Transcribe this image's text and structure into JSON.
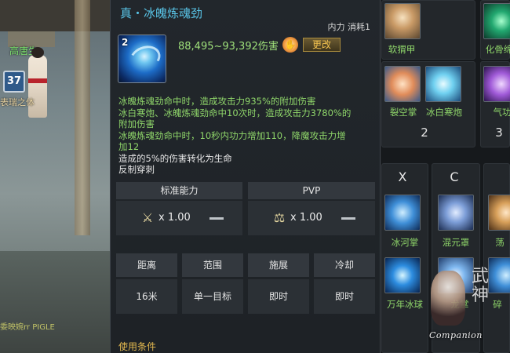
{
  "world": {
    "npc_name": "高唐生",
    "level_badge": "37",
    "label_fragment": "表瑞之体",
    "chat_fragment": "委映婉rr PIGLE"
  },
  "tooltip": {
    "title": "真・冰魄炼魂劲",
    "cost": "内力 消耗1",
    "skill_level": "2",
    "damage": "88,495~93,392伤害",
    "change_label": "更改",
    "desc_lines": [
      {
        "text": "冰魄炼魂劲命中时，造成攻击力935%的附加伤害",
        "color": "green"
      },
      {
        "text": "冰白寒炮、冰魄炼魂劲命中10次时，造成攻击力3780%的",
        "color": "green"
      },
      {
        "text": "附加伤害",
        "color": "green"
      },
      {
        "text": "冰魄炼魂劲命中时，10秒内功力增加110，降魔攻击力增",
        "color": "green"
      },
      {
        "text": "加12",
        "color": "green"
      },
      {
        "text": "造成的5%的伤害转化为生命",
        "color": "white"
      },
      {
        "text": "反制穿刺",
        "color": "white"
      }
    ],
    "standard": {
      "header": "标准能力",
      "value": "x 1.00",
      "icon": "crossed-swords-icon"
    },
    "pvp": {
      "header": "PVP",
      "value": "x 1.00",
      "icon": "pvp-icon"
    },
    "info_headers": [
      "距离",
      "范围",
      "施展",
      "冷却"
    ],
    "info_values": [
      "16米",
      "单一目标",
      "即时",
      "即时"
    ],
    "conditions": "使用条件"
  },
  "skillbar": {
    "top_labels": [
      "软猬甲",
      "化骨绵"
    ],
    "row2_labels": [
      "裂空掌",
      "冰白寒炮",
      "气功"
    ],
    "row2_nums": [
      "2",
      "3"
    ],
    "keys": [
      "X",
      "C"
    ],
    "row3_labels": [
      "冰河掌",
      "混元罩",
      "荡"
    ],
    "row4_labels": [
      "万年冰球",
      "龙掌",
      "碎"
    ],
    "brand": "Companion",
    "calligraphy": "武神"
  }
}
